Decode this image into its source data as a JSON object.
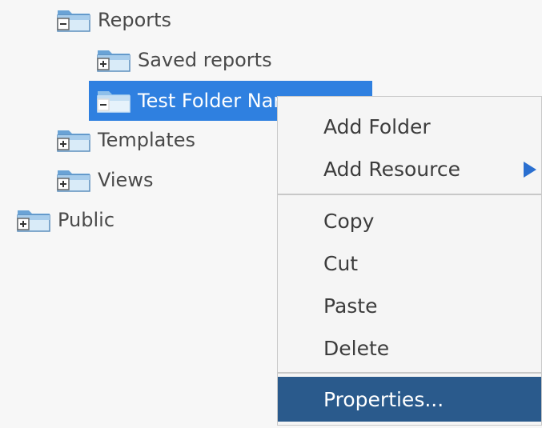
{
  "tree": {
    "reports": {
      "label": "Reports",
      "toggle": "minus"
    },
    "saved_reports": {
      "label": "Saved reports",
      "toggle": "plus"
    },
    "test_folder": {
      "label": "Test Folder Name",
      "toggle": "minus",
      "selected": true
    },
    "templates": {
      "label": "Templates",
      "toggle": "plus"
    },
    "views": {
      "label": "Views",
      "toggle": "plus"
    },
    "public": {
      "label": "Public",
      "toggle": "plus"
    }
  },
  "context_menu": {
    "add_folder": "Add Folder",
    "add_resource": "Add Resource",
    "copy": "Copy",
    "cut": "Cut",
    "paste": "Paste",
    "delete": "Delete",
    "properties": "Properties..."
  },
  "colors": {
    "selection": "#2f80e0",
    "menu_highlight": "#2a5a8c",
    "submenu_arrow": "#2a6fd0"
  },
  "icons": {
    "folder_expanded": "folder-minus-icon",
    "folder_collapsed": "folder-plus-icon",
    "submenu": "triangle-right-icon"
  }
}
